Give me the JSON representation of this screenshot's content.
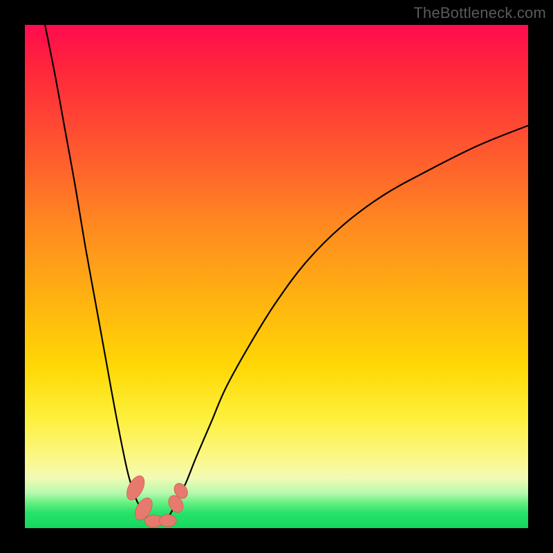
{
  "watermark": "TheBottleneck.com",
  "chart_data": {
    "type": "line",
    "title": "",
    "xlabel": "",
    "ylabel": "",
    "xlim": [
      0,
      100
    ],
    "ylim": [
      0,
      100
    ],
    "series": [
      {
        "name": "left-branch",
        "x": [
          4,
          6,
          8,
          10,
          12,
          14,
          16,
          18,
          20,
          21,
          22,
          23,
          24,
          25
        ],
        "y": [
          100,
          90,
          79,
          68,
          56,
          45,
          34,
          23,
          13,
          9,
          6,
          4,
          2.5,
          1.5
        ]
      },
      {
        "name": "right-branch",
        "x": [
          28,
          29,
          30,
          32,
          34,
          37,
          40,
          45,
          50,
          56,
          63,
          71,
          80,
          90,
          100
        ],
        "y": [
          1.5,
          3,
          5,
          9,
          14,
          21,
          28,
          37,
          45,
          53,
          60,
          66,
          71,
          76,
          80
        ]
      }
    ],
    "valley_floor": {
      "x_range": [
        25,
        28
      ],
      "y": 1.2
    },
    "markers": [
      {
        "name": "blob-left-upper",
        "x": 22.0,
        "y": 8.0,
        "rx": 1.4,
        "ry": 2.6,
        "rot": 28
      },
      {
        "name": "blob-left-lower",
        "x": 23.6,
        "y": 3.8,
        "rx": 1.4,
        "ry": 2.4,
        "rot": 30
      },
      {
        "name": "blob-floor-left",
        "x": 25.6,
        "y": 1.4,
        "rx": 1.8,
        "ry": 1.2,
        "rot": 0
      },
      {
        "name": "blob-floor-right",
        "x": 28.4,
        "y": 1.5,
        "rx": 1.7,
        "ry": 1.2,
        "rot": 0
      },
      {
        "name": "blob-right-low",
        "x": 30.0,
        "y": 4.8,
        "rx": 1.3,
        "ry": 1.8,
        "rot": -30
      },
      {
        "name": "blob-right-up",
        "x": 31.0,
        "y": 7.4,
        "rx": 1.2,
        "ry": 1.6,
        "rot": -32
      }
    ]
  }
}
